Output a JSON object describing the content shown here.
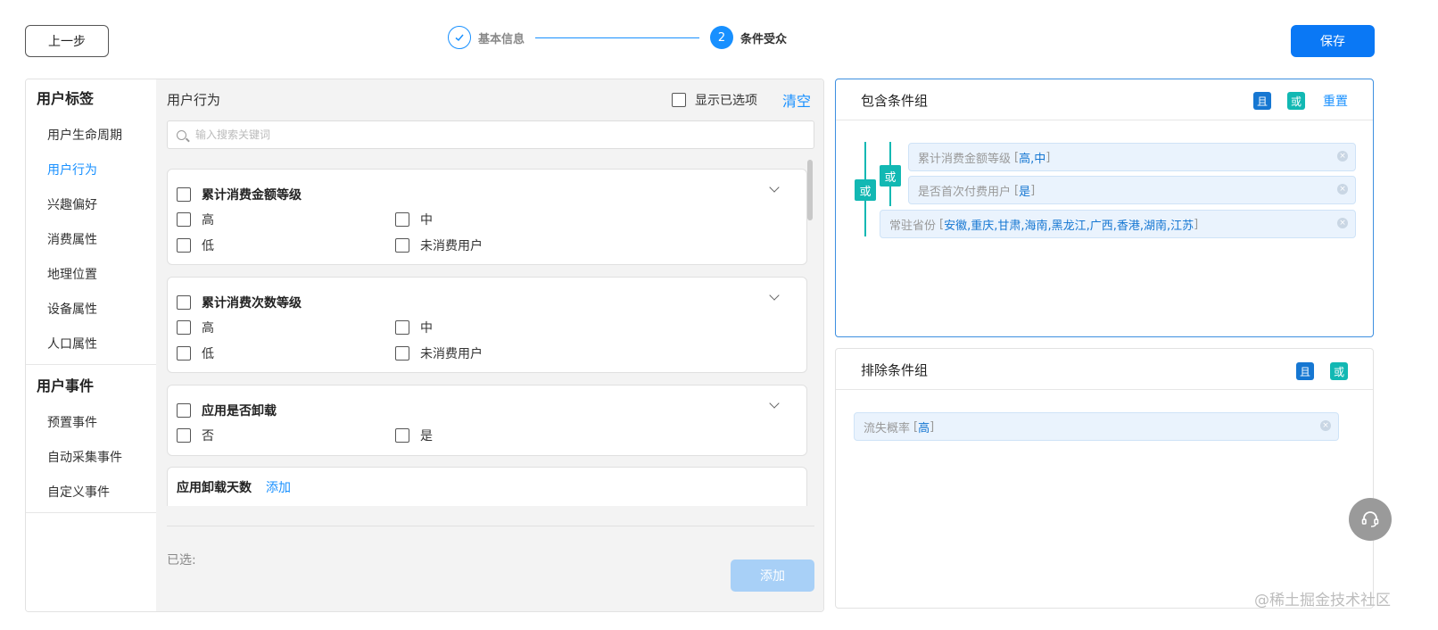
{
  "header": {
    "back_label": "上一步",
    "save_label": "保存",
    "steps": [
      {
        "label": "基本信息",
        "state": "done",
        "icon": "check-icon"
      },
      {
        "label": "条件受众",
        "state": "active",
        "number": "2"
      }
    ]
  },
  "nav": {
    "groups": [
      {
        "title": "用户标签",
        "items": [
          "用户生命周期",
          "用户行为",
          "兴趣偏好",
          "消费属性",
          "地理位置",
          "设备属性",
          "人口属性"
        ],
        "active_index": 1
      },
      {
        "title": "用户事件",
        "items": [
          "预置事件",
          "自动采集事件",
          "自定义事件"
        ]
      }
    ]
  },
  "content": {
    "title": "用户行为",
    "show_selected_label": "显示已选项",
    "clear_label": "清空",
    "search_placeholder": "输入搜索关键词",
    "cards": [
      {
        "title": "累计消费金额等级",
        "options": [
          "高",
          "中",
          "低",
          "未消费用户"
        ]
      },
      {
        "title": "累计消费次数等级",
        "options": [
          "高",
          "中",
          "低",
          "未消费用户"
        ]
      },
      {
        "title": "应用是否卸载",
        "options": [
          "否",
          "是"
        ]
      }
    ],
    "add_card": {
      "title": "应用卸载天数",
      "link": "添加"
    },
    "selected_label": "已选:",
    "add_button": "添加"
  },
  "include_group": {
    "title": "包含条件组",
    "and_label": "且",
    "or_label": "或",
    "reset_label": "重置",
    "outer_or": "或",
    "inner_or": "或",
    "conditions": [
      {
        "name": "累计消费金额等级",
        "values": "高,中"
      },
      {
        "name": "是否首次付费用户",
        "values": "是"
      },
      {
        "name": "常驻省份",
        "values": "安徽,重庆,甘肃,海南,黑龙江,广西,香港,湖南,江苏"
      }
    ]
  },
  "exclude_group": {
    "title": "排除条件组",
    "and_label": "且",
    "or_label": "或",
    "conditions": [
      {
        "name": "流失概率",
        "values": "高"
      }
    ]
  },
  "watermark": "@稀土掘金技术社区",
  "colors": {
    "primary": "#1890ff",
    "teal": "#12b8b3",
    "save": "#0a78f5",
    "add_disabled": "#a8d0f7"
  }
}
